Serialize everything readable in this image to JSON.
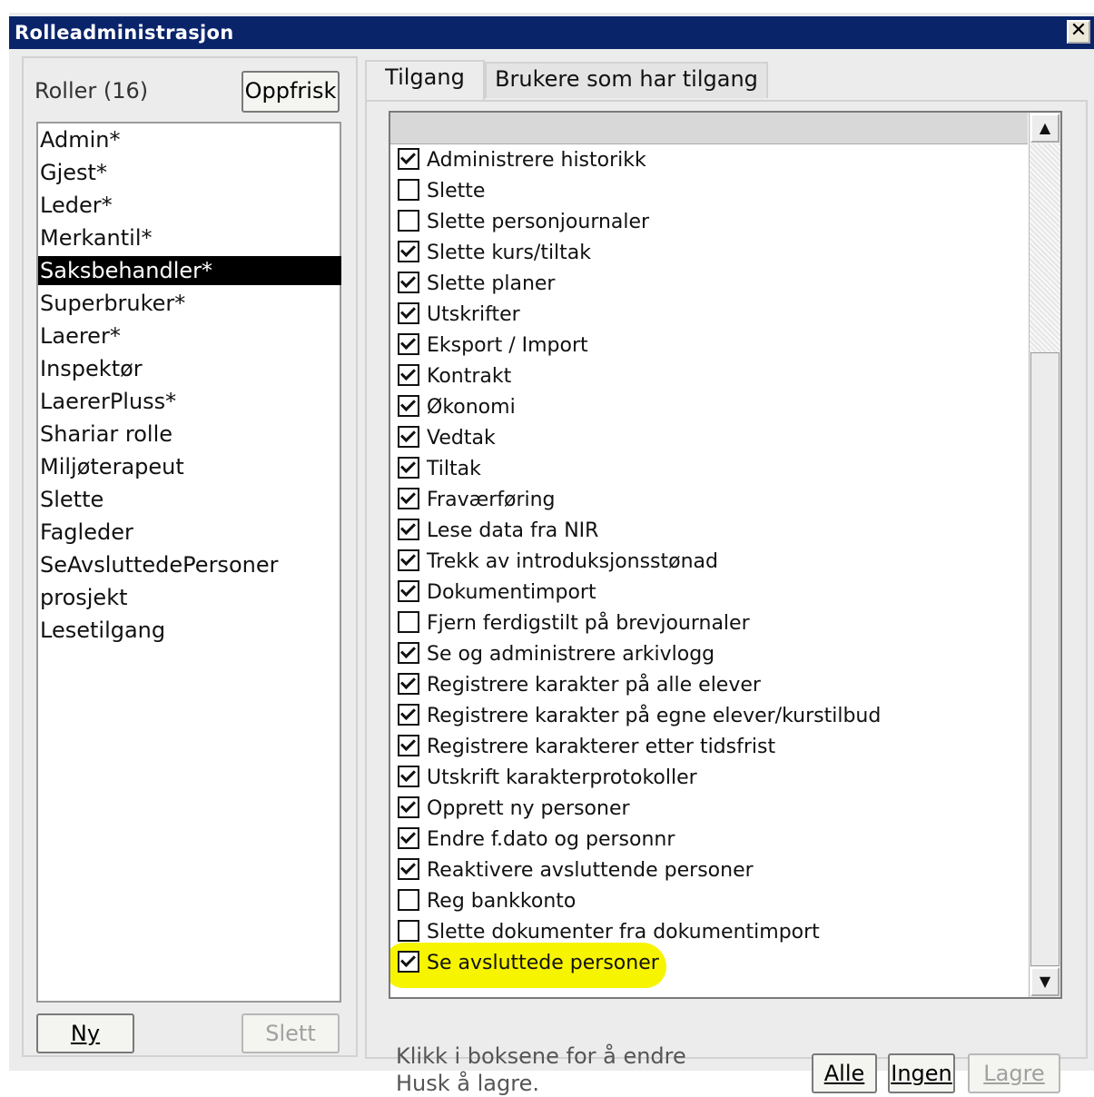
{
  "window": {
    "title": "Rolleadministrasjon",
    "close_glyph": "✕"
  },
  "roles": {
    "label": "Roller (16)",
    "refresh_label": "Oppfrisk",
    "items": [
      "Admin*",
      "Gjest*",
      "Leder*",
      "Merkantil*",
      "Saksbehandler*",
      "Superbruker*",
      "Laerer*",
      "Inspektør",
      "LaererPluss*",
      "Shariar rolle",
      "Miljøterapeut",
      "Slette",
      "Fagleder",
      "SeAvsluttedePersoner",
      "prosjekt",
      "Lesetilgang"
    ],
    "selected": "Saksbehandler*",
    "new_label": "Ny",
    "delete_label": "Slett"
  },
  "tabs": {
    "access": "Tilgang",
    "users_with_access": "Brukere som har tilgang"
  },
  "permissions": [
    {
      "label": "Administrere historikk",
      "checked": true
    },
    {
      "label": "Slette",
      "checked": false
    },
    {
      "label": "Slette personjournaler",
      "checked": false
    },
    {
      "label": "Slette kurs/tiltak",
      "checked": true
    },
    {
      "label": "Slette planer",
      "checked": true
    },
    {
      "label": "Utskrifter",
      "checked": true
    },
    {
      "label": "Eksport / Import",
      "checked": true
    },
    {
      "label": "Kontrakt",
      "checked": true
    },
    {
      "label": "Økonomi",
      "checked": true
    },
    {
      "label": "Vedtak",
      "checked": true
    },
    {
      "label": "Tiltak",
      "checked": true
    },
    {
      "label": "Fraværføring",
      "checked": true
    },
    {
      "label": "Lese data fra NIR",
      "checked": true
    },
    {
      "label": "Trekk av introduksjonsstønad",
      "checked": true
    },
    {
      "label": "Dokumentimport",
      "checked": true
    },
    {
      "label": "Fjern ferdigstilt på brevjournaler",
      "checked": false
    },
    {
      "label": "Se og administrere arkivlogg",
      "checked": true
    },
    {
      "label": "Registrere karakter på alle elever",
      "checked": true
    },
    {
      "label": "Registrere karakter på egne elever/kurstilbud",
      "checked": true
    },
    {
      "label": "Registrere karakterer etter tidsfrist",
      "checked": true
    },
    {
      "label": "Utskrift karakterprotokoller",
      "checked": true
    },
    {
      "label": "Opprett ny personer",
      "checked": true
    },
    {
      "label": "Endre f.dato og personnr",
      "checked": true
    },
    {
      "label": "Reaktivere avsluttende personer",
      "checked": true
    },
    {
      "label": "Reg bankkonto",
      "checked": false
    },
    {
      "label": "Slette dokumenter fra dokumentimport",
      "checked": false
    },
    {
      "label": "Se avsluttede personer",
      "checked": true
    }
  ],
  "highlight_color": "#f7f400",
  "hint": {
    "line1": "Klikk i boksene for å endre",
    "line2": "Husk å lagre."
  },
  "buttons": {
    "all": "Alle",
    "none": "Ingen",
    "save": "Lagre"
  },
  "scroll": {
    "up": "▲",
    "down": "▼"
  }
}
